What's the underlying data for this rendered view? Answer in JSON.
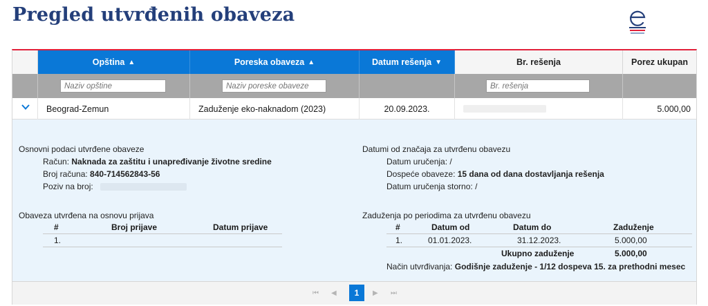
{
  "page": {
    "title": "Pregled utvrđenih obaveza"
  },
  "columns": {
    "opstina": {
      "label": "Opština",
      "sort": "▲"
    },
    "poreska": {
      "label": "Poreska obaveza",
      "sort": "▲"
    },
    "datum": {
      "label": "Datum rešenja",
      "sort": "▼"
    },
    "br_resenja": {
      "label": "Br. rešenja"
    },
    "porez": {
      "label": "Porez ukupan"
    }
  },
  "filters": {
    "opstina_placeholder": "Naziv opštine",
    "poreska_placeholder": "Naziv poreske obaveze",
    "br_resenja_placeholder": "Br. rešenja"
  },
  "row": {
    "opstina": "Beograd-Zemun",
    "poreska": "Zaduženje eko-naknadom (2023)",
    "datum": "20.09.2023.",
    "porez": "5.000,00"
  },
  "detail": {
    "osnovni": {
      "title": "Osnovni podaci utvrđene obaveze",
      "racun_label": "Račun:",
      "racun_value": "Naknada za zaštitu i unapređivanje životne sredine",
      "broj_label": "Broj računa:",
      "broj_value": "840-714562843-56",
      "poziv_label": "Poziv na broj:"
    },
    "datumi": {
      "title": "Datumi od značaja za utvrđenu obavezu",
      "urucenja": "Datum uručenja: /",
      "dospece_label": "Dospeće obaveze:",
      "dospece_value": "15 dana od dana dostavljanja rešenja",
      "storno": "Datum uručenja storno: /"
    },
    "prijave": {
      "title": "Obaveza utvrđena na osnovu prijava",
      "h_num": "#",
      "h_broj": "Broj prijave",
      "h_datum": "Datum prijave",
      "row_num": "1."
    },
    "zaduzenja": {
      "title": "Zaduženja po periodima za utvrđenu obavezu",
      "h_num": "#",
      "h_od": "Datum od",
      "h_do": "Datum do",
      "h_zad": "Zaduženje",
      "row_num": "1.",
      "row_od": "01.01.2023.",
      "row_do": "31.12.2023.",
      "row_zad": "5.000,00",
      "ukupno_label": "Ukupno zaduženje",
      "ukupno_value": "5.000,00",
      "nacin_label": "Način utvrđivanja:",
      "nacin_value": "Godišnje zaduženje - 1/12 dospeva 15. za prethodni mesec"
    }
  },
  "pager": {
    "first": "⏮",
    "prev": "◀",
    "page": "1",
    "next": "▶",
    "last": "⏭"
  },
  "icons": {
    "logo": "e-logo-icon",
    "expand": "chevron-down-icon"
  },
  "colors": {
    "accent": "#0a78d7",
    "title": "#243f7a",
    "top_border": "#e2203a",
    "detail_bg": "#eaf4fc"
  }
}
